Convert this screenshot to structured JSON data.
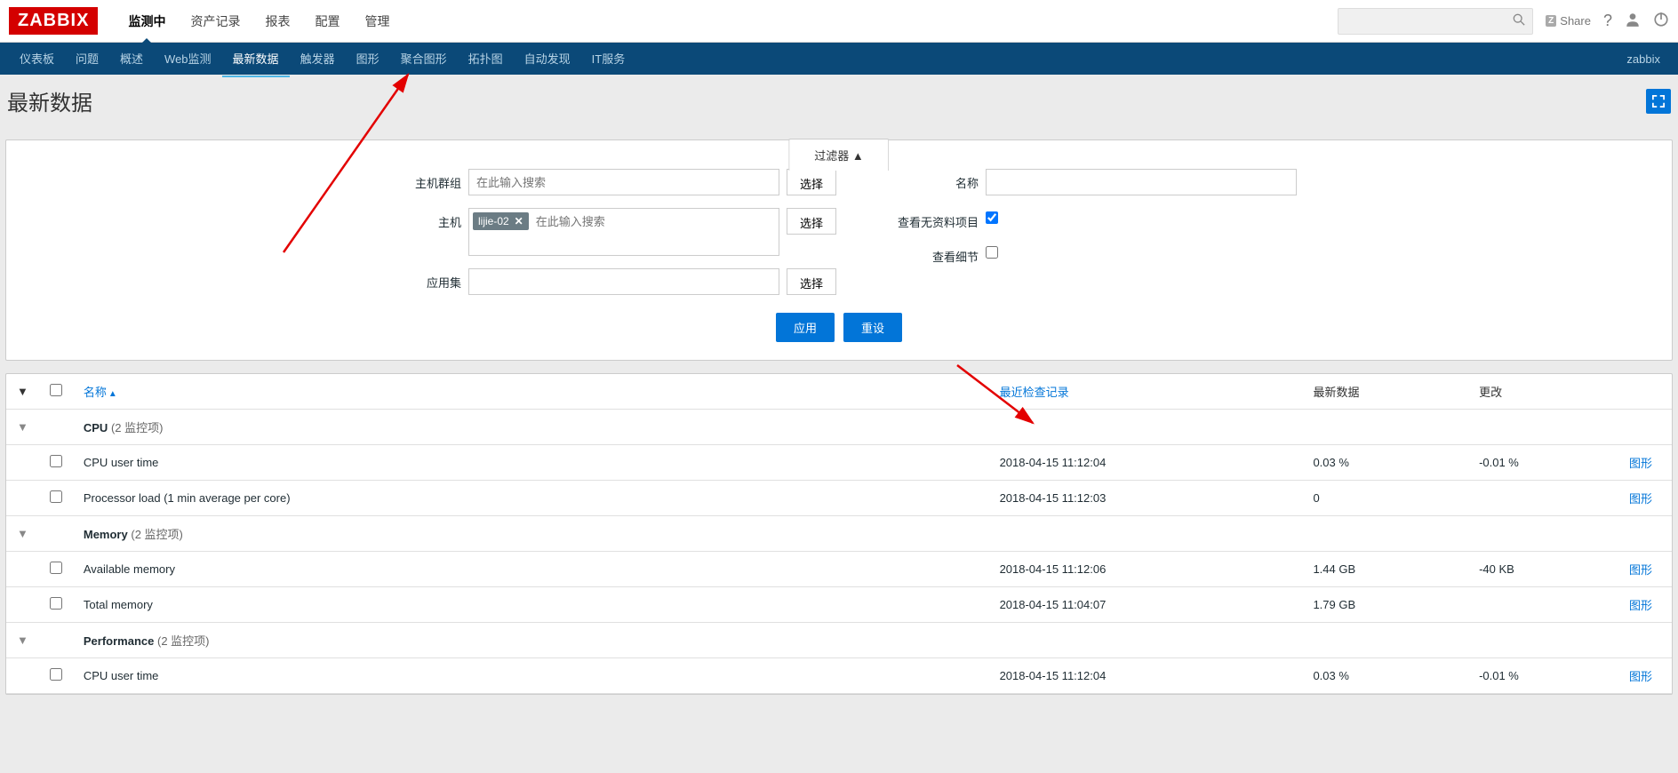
{
  "logo": "ZABBIX",
  "topNav": [
    "监测中",
    "资产记录",
    "报表",
    "配置",
    "管理"
  ],
  "topNavActive": 0,
  "share": "Share",
  "subNav": [
    "仪表板",
    "问题",
    "概述",
    "Web监测",
    "最新数据",
    "触发器",
    "图形",
    "聚合图形",
    "拓扑图",
    "自动发现",
    "IT服务"
  ],
  "subNavActive": 4,
  "subNavRight": "zabbix",
  "pageTitle": "最新数据",
  "filter": {
    "tabLabel": "过滤器 ▲",
    "hostGroupLabel": "主机群组",
    "hostGroupPlaceholder": "在此输入搜索",
    "hostLabel": "主机",
    "hostTag": "lijie-02",
    "hostPlaceholder": "在此输入搜索",
    "appLabel": "应用集",
    "selectBtn": "选择",
    "nameLabel": "名称",
    "showNoDataLabel": "查看无资料项目",
    "showNoData": true,
    "showDetailsLabel": "查看细节",
    "showDetails": false,
    "applyBtn": "应用",
    "resetBtn": "重设"
  },
  "table": {
    "colName": "名称",
    "colLastCheck": "最近检查记录",
    "colLatest": "最新数据",
    "colChange": "更改",
    "graphLink": "图形",
    "rows": [
      {
        "type": "group",
        "name": "CPU",
        "count": "(2 监控项)"
      },
      {
        "type": "item",
        "name": "CPU user time",
        "lastCheck": "2018-04-15 11:12:04",
        "latest": "0.03 %",
        "change": "-0.01 %",
        "graph": true
      },
      {
        "type": "item",
        "name": "Processor load (1 min average per core)",
        "lastCheck": "2018-04-15 11:12:03",
        "latest": "0",
        "change": "",
        "graph": true
      },
      {
        "type": "group",
        "name": "Memory",
        "count": "(2 监控项)"
      },
      {
        "type": "item",
        "name": "Available memory",
        "lastCheck": "2018-04-15 11:12:06",
        "latest": "1.44 GB",
        "change": "-40 KB",
        "graph": true
      },
      {
        "type": "item",
        "name": "Total memory",
        "lastCheck": "2018-04-15 11:04:07",
        "latest": "1.79 GB",
        "change": "",
        "graph": true
      },
      {
        "type": "group",
        "name": "Performance",
        "count": "(2 监控项)"
      },
      {
        "type": "item",
        "name": "CPU user time",
        "lastCheck": "2018-04-15 11:12:04",
        "latest": "0.03 %",
        "change": "-0.01 %",
        "graph": true
      }
    ]
  }
}
